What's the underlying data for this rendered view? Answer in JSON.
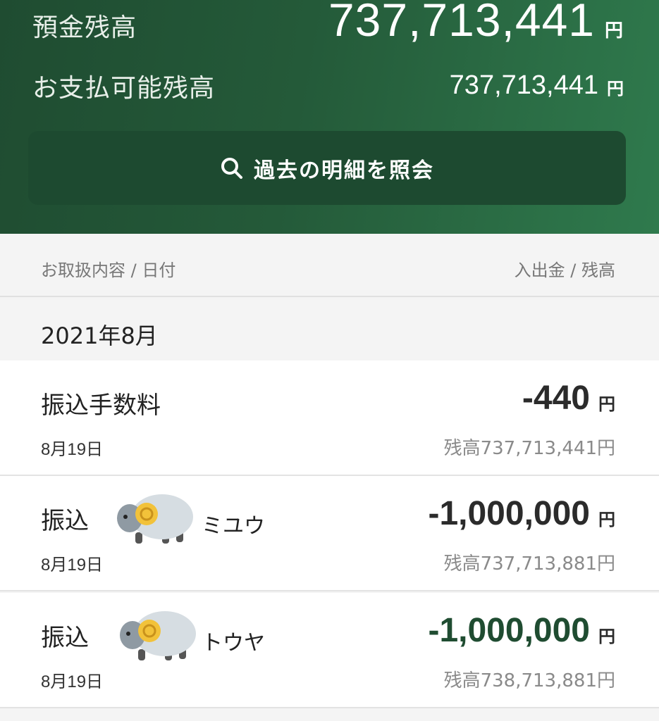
{
  "header": {
    "deposit_label": "預金残高",
    "deposit_amount": "737,713,441",
    "deposit_unit": "円",
    "available_label": "お支払可能残高",
    "available_amount": "737,713,441",
    "available_unit": "円",
    "history_button_label": "過去の明細を照会"
  },
  "columns": {
    "left": "お取扱内容 / 日付",
    "right": "入出金 / 残高"
  },
  "month": "2021年8月",
  "transactions": [
    {
      "title": "振込手数料",
      "name": "",
      "date": "8月19日",
      "amount": "-440",
      "unit": "円",
      "balance": "残高737,713,441円",
      "amount_color": "#2b2b2b"
    },
    {
      "title": "振込",
      "name": "ミユウ",
      "date": "8月19日",
      "amount": "-1,000,000",
      "unit": "円",
      "balance": "残高737,713,881円",
      "amount_color": "#2b2b2b"
    },
    {
      "title": "振込",
      "name": "トウヤ",
      "date": "8月19日",
      "amount": "-1,000,000",
      "unit": "円",
      "balance": "残高738,713,881円",
      "amount_color": "#1f4c31"
    }
  ],
  "colors": {
    "header_dark": "#1f4c31",
    "header_light": "#2f7a4d",
    "button": "#1d4a30"
  },
  "icons": {
    "search": "search-icon",
    "sticker": "ram-sticker-icon"
  }
}
